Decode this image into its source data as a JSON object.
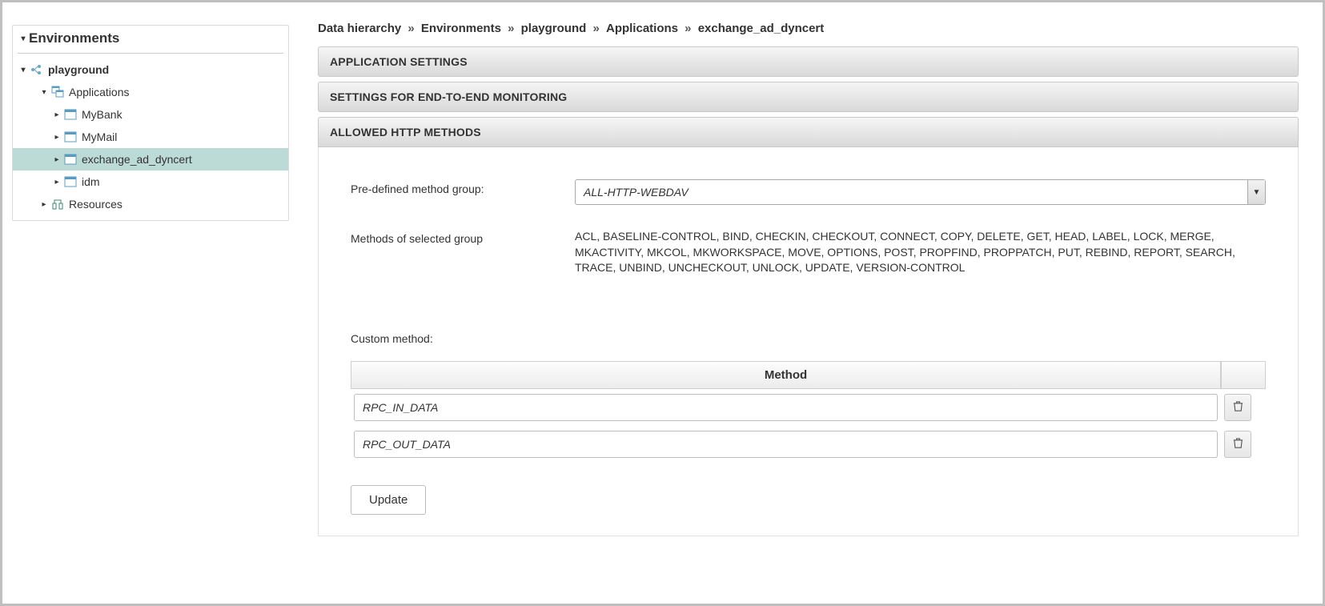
{
  "sidebar": {
    "rootTitle": "Environments",
    "tree": {
      "name": "playground",
      "applicationsLabel": "Applications",
      "apps": [
        {
          "label": "MyBank",
          "selected": false
        },
        {
          "label": "MyMail",
          "selected": false
        },
        {
          "label": "exchange_ad_dyncert",
          "selected": true
        },
        {
          "label": "idm",
          "selected": false
        }
      ],
      "resourcesLabel": "Resources"
    }
  },
  "breadcrumb": [
    "Data hierarchy",
    "Environments",
    "playground",
    "Applications",
    "exchange_ad_dyncert"
  ],
  "panels": {
    "appSettings": "APPLICATION SETTINGS",
    "e2eMonitoring": "SETTINGS FOR END-TO-END MONITORING",
    "allowedHttp": "ALLOWED HTTP METHODS"
  },
  "form": {
    "predefinedGroupLabel": "Pre-defined method group:",
    "predefinedGroupValue": "ALL-HTTP-WEBDAV",
    "methodsOfGroupLabel": "Methods of selected group",
    "methodsOfGroupValue": "ACL, BASELINE-CONTROL, BIND, CHECKIN, CHECKOUT, CONNECT, COPY, DELETE, GET, HEAD, LABEL, LOCK, MERGE, MKACTIVITY, MKCOL, MKWORKSPACE, MOVE, OPTIONS, POST, PROPFIND, PROPPATCH, PUT, REBIND, REPORT, SEARCH, TRACE, UNBIND, UNCHECKOUT, UNLOCK, UPDATE, VERSION-CONTROL",
    "customMethodLabel": "Custom method:",
    "tableHeaderMethod": "Method",
    "customMethods": [
      "RPC_IN_DATA",
      "RPC_OUT_DATA"
    ],
    "updateLabel": "Update"
  }
}
